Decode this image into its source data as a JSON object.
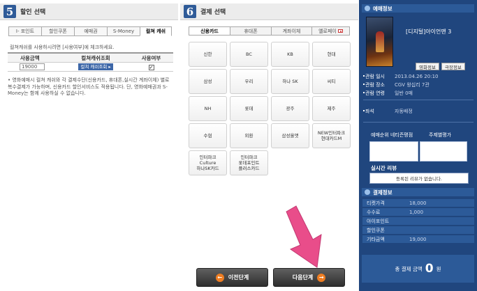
{
  "discount": {
    "step_number": "5",
    "title": "할인 선택",
    "tabs": [
      "I- 포인트",
      "할인쿠폰",
      "예매권",
      "S-Money",
      "컬쳐 캐쉬"
    ],
    "active_tab": "컬쳐 캐쉬",
    "hint": "컬쳐캐쉬를 사용하시려면 [사용여부]에 체크하세요.",
    "table": {
      "headers": [
        "사용금액",
        "컬쳐캐쉬조회",
        "사용여부"
      ],
      "amount_value": "19000",
      "lookup_label": "컬쳐 캐쉬조회 ▸",
      "use_checked": true
    },
    "notice": "• 영화예매시 컬쳐 캐쉬와 각 결제수단(신용카드, 휴대폰,실시간 계좌이체) 별로 복수결제가 가능하며, 신용카드 할인서비스도 적용됩니다. 단, 영화예매권과 S-Money는 함께 사용하실 수 없습니다."
  },
  "payment": {
    "step_number": "6",
    "title": "결제 선택",
    "tabs": [
      "신용카드",
      "휴대폰",
      "계좌이체",
      "옐로페이"
    ],
    "active_tab": "신용카드",
    "cards": [
      "신한",
      "BC",
      "KB",
      "현대",
      "삼성",
      "우리",
      "하나 SK",
      "씨티",
      "NH",
      "롯데",
      "광주",
      "제주",
      "수협",
      "외환",
      "삼성올앳",
      "NEW인터파크\n현대카드M",
      "인터파크\nCulture\n하나SK카드",
      "인터파크\n롯데포인트\n플러스카드"
    ]
  },
  "nav": {
    "prev_label": "이전단계",
    "prev_icon": "←",
    "next_label": "다음단계",
    "next_icon": "→"
  },
  "booking": {
    "header": "예매정보",
    "movie_title": "[디지털]아이언맨 3",
    "movie_info_btn": "영화정보",
    "theater_info_btn": "극장정보",
    "rows": [
      {
        "k": "관람 일시",
        "v": "2013.04.26 20:10"
      },
      {
        "k": "관람 장소",
        "v": "CGV 왕십리 7관"
      },
      {
        "k": "관람 연령",
        "v": "일반 0매"
      }
    ],
    "seat_label": "좌석",
    "seat_value": "자동배정",
    "rank_label": "예매순위 네티즌평점",
    "audience_label": "주제별평가",
    "review_label": "실시간 리뷰",
    "review_text": "등록된 리뷰가 없습니다."
  },
  "payinfo": {
    "header": "결제정보",
    "rows": [
      {
        "k": "티켓가격",
        "v": "18,000"
      },
      {
        "k": "수수료",
        "v": "1,000"
      },
      {
        "k": "아이포인트",
        "v": ""
      },
      {
        "k": "할인쿠폰",
        "v": ""
      },
      {
        "k": "기타금액",
        "v": "19,000"
      }
    ],
    "total_label": "총 결제 금액",
    "total_value": "0",
    "total_unit": "원"
  },
  "colors": {
    "sidebar_bg": "#20467e",
    "sidebar_header": "#2c5a98",
    "accent_orange": "#ee7d22",
    "arrow_pink": "#e94d8a"
  }
}
